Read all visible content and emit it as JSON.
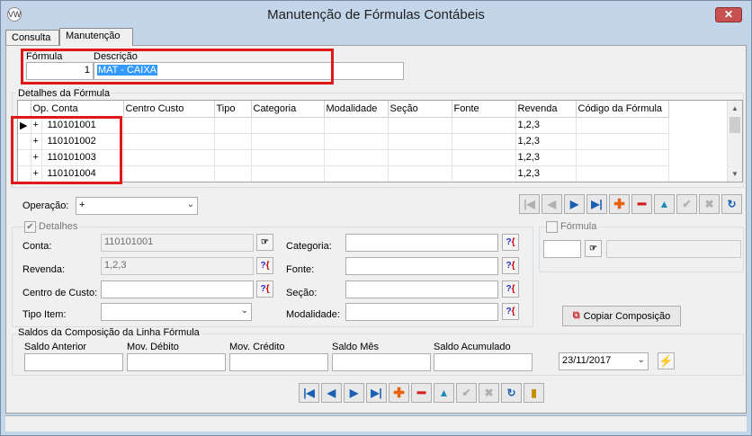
{
  "window": {
    "title": "Manutenção de Fórmulas Contábeis",
    "close_label": "✕"
  },
  "tabs": [
    {
      "label": "Consulta"
    },
    {
      "label": "Manutenção"
    }
  ],
  "header": {
    "formula_label": "Fórmula",
    "formula_value": "1",
    "descricao_label": "Descrição",
    "descricao_value": "MAT - CAIXA"
  },
  "detalhes_group": {
    "title": "Detalhes da Fórmula",
    "columns": [
      "Op.",
      "Conta",
      "Centro Custo",
      "Tipo",
      "Categoria",
      "Modalidade",
      "Seção",
      "Fonte",
      "Revenda",
      "Código da Fórmula"
    ],
    "rows": [
      {
        "op": "+",
        "conta": "110101001",
        "revenda": "1,2,3",
        "current": true
      },
      {
        "op": "+",
        "conta": "110101002",
        "revenda": "1,2,3",
        "current": false
      },
      {
        "op": "+",
        "conta": "110101003",
        "revenda": "1,2,3",
        "current": false
      },
      {
        "op": "+",
        "conta": "110101004",
        "revenda": "1,2,3",
        "current": false
      }
    ]
  },
  "operacao": {
    "label": "Operação:",
    "value": "+"
  },
  "detalhes_panel": {
    "checkbox_label": "Detalhes",
    "conta_label": "Conta:",
    "conta_value": "110101001",
    "revenda_label": "Revenda:",
    "revenda_value": "1,2,3",
    "centro_label": "Centro de Custo:",
    "centro_value": "",
    "tipo_label": "Tipo Item:",
    "tipo_value": "",
    "categoria_label": "Categoria:",
    "fonte_label": "Fonte:",
    "secao_label": "Seção:",
    "modalidade_label": "Modalidade:"
  },
  "formula_panel": {
    "checkbox_label": "Fórmula"
  },
  "copy_button": {
    "label": "Copiar Composição"
  },
  "saldos": {
    "title": "Saldos da Composição da Linha Fórmula",
    "labels": [
      "Saldo Anterior",
      "Mov. Débito",
      "Mov. Crédito",
      "Saldo Mês",
      "Saldo Acumulado"
    ],
    "date": "23/11/2017"
  },
  "icons": {
    "first": "first-record-icon",
    "prev": "previous-record-icon",
    "next": "next-record-icon",
    "last": "last-record-icon",
    "add": "add-icon",
    "remove": "remove-icon",
    "edit": "edit-icon",
    "confirm": "confirm-icon",
    "cancel": "cancel-icon",
    "refresh": "refresh-icon",
    "exit": "exit-door-icon",
    "lookup": "lookup-hand-icon",
    "help": "help-search-icon",
    "lightning": "lightning-icon"
  },
  "colors": {
    "highlight": "#3399ff",
    "red_annotation": "#e01818",
    "title_bg": "#c3d6e9"
  }
}
